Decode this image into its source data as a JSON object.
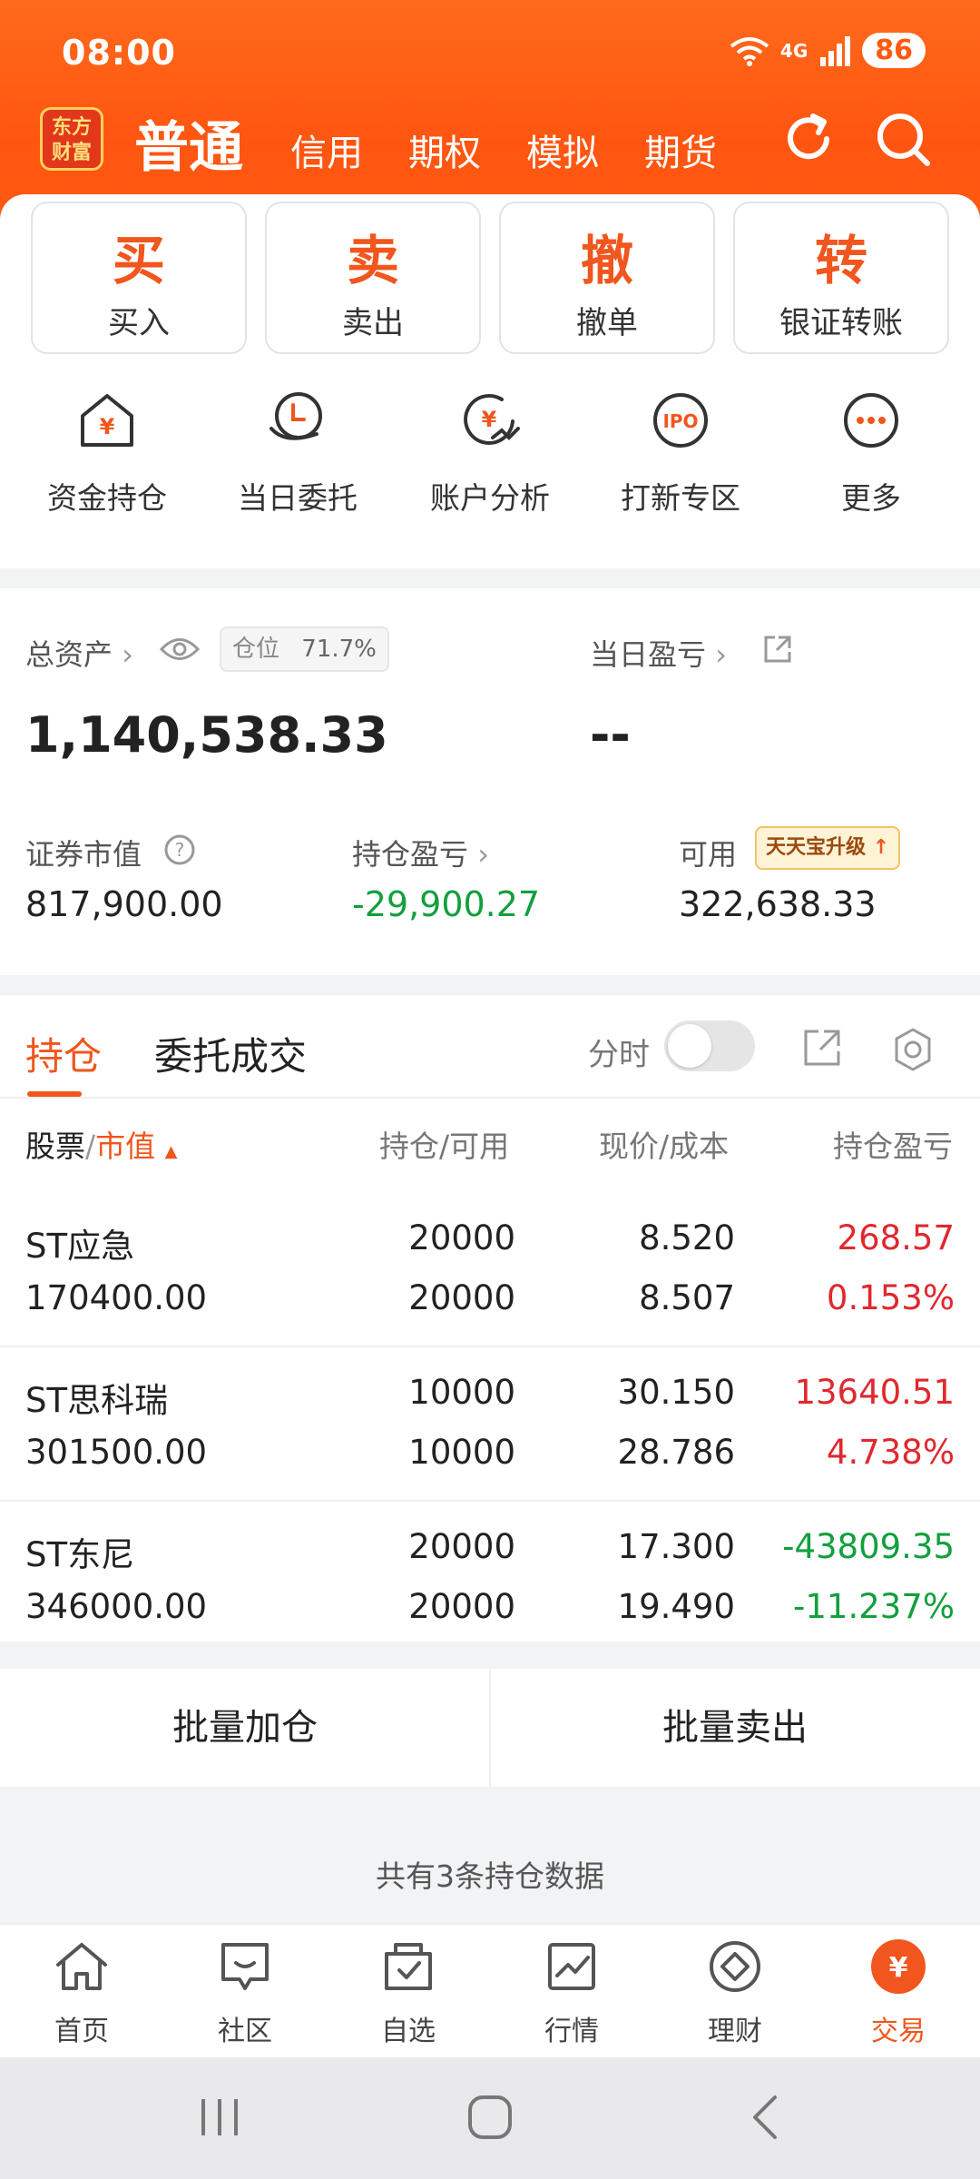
{
  "status_bar": {
    "time": "08:00",
    "network": "4G",
    "battery": "86"
  },
  "top_nav": {
    "logo": [
      "东方",
      "财富"
    ],
    "active": "普通",
    "items": [
      "信用",
      "期权",
      "模拟",
      "期货"
    ]
  },
  "trade_buttons": [
    {
      "big": "买",
      "small": "买入"
    },
    {
      "big": "卖",
      "small": "卖出"
    },
    {
      "big": "撤",
      "small": "撤单"
    },
    {
      "big": "转",
      "small": "银证转账"
    }
  ],
  "functions": [
    {
      "label": "资金持仓",
      "icon": "house-yen-icon"
    },
    {
      "label": "当日委托",
      "icon": "hand-order-icon"
    },
    {
      "label": "账户分析",
      "icon": "yen-analysis-icon"
    },
    {
      "label": "打新专区",
      "icon": "ipo-icon"
    },
    {
      "label": "更多",
      "icon": "more-icon"
    }
  ],
  "assets": {
    "total_label": "总资产",
    "position_label": "仓位",
    "position_pct": "71.7%",
    "total_value": "1,140,538.33",
    "daily_pl_label": "当日盈亏",
    "daily_pl_value": "--",
    "market_value_label": "证券市值",
    "market_value": "817,900.00",
    "hold_pl_label": "持仓盈亏",
    "hold_pl_value": "-29,900.27",
    "available_label": "可用",
    "available_badge": "天天宝升级",
    "available_value": "322,638.33"
  },
  "holdings": {
    "tabs": [
      "持仓",
      "委托成交"
    ],
    "toggle_label": "分时",
    "headers": {
      "stock": "股票",
      "sep": "/",
      "market": "市值",
      "qty": "持仓/可用",
      "price": "现价/成本",
      "pl": "持仓盈亏"
    },
    "rows": [
      {
        "name": "ST应急",
        "value": "170400.00",
        "hold": "20000",
        "avail": "20000",
        "price": "8.520",
        "cost": "8.507",
        "pl": "268.57",
        "pl_pct": "0.153%",
        "dir": "up"
      },
      {
        "name": "ST思科瑞",
        "value": "301500.00",
        "hold": "10000",
        "avail": "10000",
        "price": "30.150",
        "cost": "28.786",
        "pl": "13640.51",
        "pl_pct": "4.738%",
        "dir": "up"
      },
      {
        "name": "ST东尼",
        "value": "346000.00",
        "hold": "20000",
        "avail": "20000",
        "price": "17.300",
        "cost": "19.490",
        "pl": "-43809.35",
        "pl_pct": "-11.237%",
        "dir": "down"
      }
    ]
  },
  "actions": [
    "批量加仓",
    "批量卖出"
  ],
  "footer_note": "共有3条持仓数据",
  "bottom_nav": [
    {
      "label": "首页",
      "icon": "home-icon"
    },
    {
      "label": "社区",
      "icon": "community-icon"
    },
    {
      "label": "自选",
      "icon": "watchlist-icon"
    },
    {
      "label": "行情",
      "icon": "market-chart-icon"
    },
    {
      "label": "理财",
      "icon": "wealth-icon"
    },
    {
      "label": "交易",
      "icon": "trade-icon",
      "active": true
    }
  ],
  "colors": {
    "brand": "#ff5a10",
    "accent": "#f0561d",
    "up": "#e0282e",
    "down": "#11a03c"
  }
}
